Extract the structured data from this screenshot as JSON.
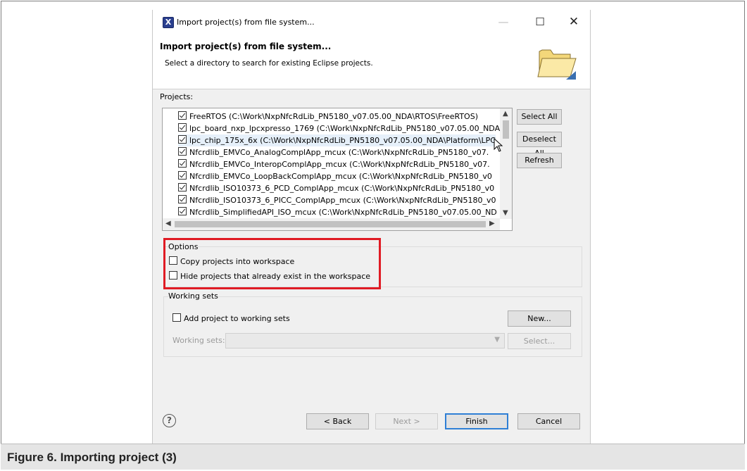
{
  "window": {
    "title": "Import project(s) from file system...",
    "minimize": "—",
    "maximize": "☐",
    "close": "✕"
  },
  "header": {
    "title": "Import project(s) from file system...",
    "description": "Select a directory to search for existing Eclipse projects."
  },
  "projects": {
    "label": "Projects:",
    "items": [
      {
        "label": "FreeRTOS (C:\\Work\\NxpNfcRdLib_PN5180_v07.05.00_NDA\\RTOS\\FreeRTOS)",
        "checked": true
      },
      {
        "label": "lpc_board_nxp_lpcxpresso_1769 (C:\\Work\\NxpNfcRdLib_PN5180_v07.05.00_NDA",
        "checked": true
      },
      {
        "label": "lpc_chip_175x_6x (C:\\Work\\NxpNfcRdLib_PN5180_v07.05.00_NDA\\Platform\\LPC",
        "checked": true
      },
      {
        "label": "Nfcrdlib_EMVCo_AnalogComplApp_mcux (C:\\Work\\NxpNfcRdLib_PN5180_v07.",
        "checked": true
      },
      {
        "label": "Nfcrdlib_EMVCo_InteropComplApp_mcux (C:\\Work\\NxpNfcRdLib_PN5180_v07.",
        "checked": true
      },
      {
        "label": "Nfcrdlib_EMVCo_LoopBackComplApp_mcux (C:\\Work\\NxpNfcRdLib_PN5180_v0",
        "checked": true
      },
      {
        "label": "Nfcrdlib_ISO10373_6_PCD_ComplApp_mcux (C:\\Work\\NxpNfcRdLib_PN5180_v0",
        "checked": true
      },
      {
        "label": "Nfcrdlib_ISO10373_6_PICC_ComplApp_mcux (C:\\Work\\NxpNfcRdLib_PN5180_v0",
        "checked": true
      },
      {
        "label": "Nfcrdlib_SimplifiedAPI_ISO_mcux (C:\\Work\\NxpNfcRdLib_PN5180_v07.05.00_ND",
        "checked": true
      }
    ],
    "select_all": "Select All",
    "deselect_all": "Deselect All",
    "refresh": "Refresh"
  },
  "options": {
    "label": "Options",
    "copy_projects": "Copy projects into workspace",
    "hide_existing": "Hide projects that already exist in the workspace"
  },
  "working_sets": {
    "label": "Working sets",
    "add_to_sets": "Add project to working sets",
    "new_button": "New...",
    "sets_label": "Working sets:",
    "select_button": "Select..."
  },
  "footer": {
    "help": "?",
    "back": "< Back",
    "next": "Next >",
    "finish": "Finish",
    "cancel": "Cancel"
  },
  "caption": "Figure 6.  Importing project (3)",
  "colors": {
    "highlight_box": "#e01b24",
    "dialog_bg": "#f0f0f0",
    "caption_bg": "#e5e5e5"
  }
}
